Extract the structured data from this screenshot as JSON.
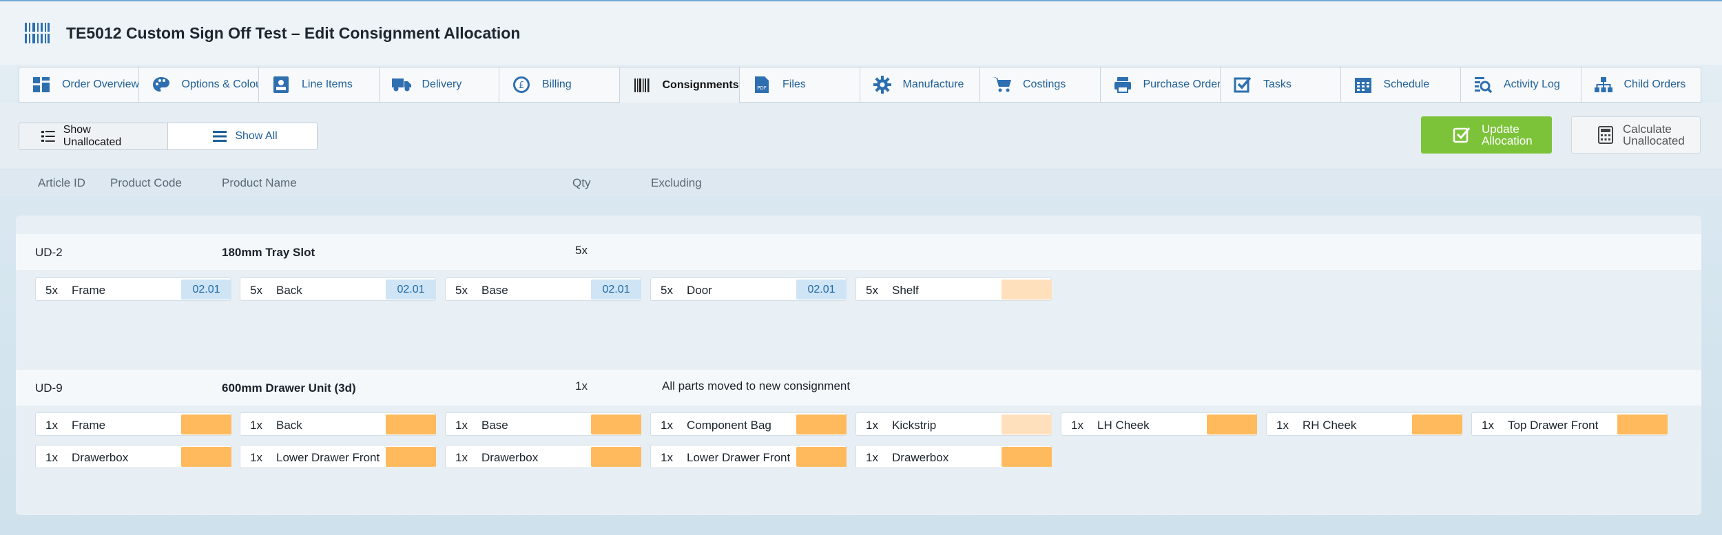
{
  "header": {
    "title": "TE5012 Custom Sign Off Test – Edit Consignment Allocation",
    "logo_icon": "barcode-icon"
  },
  "tabs": [
    {
      "label": "Order Overview",
      "icon": "dashboard-icon"
    },
    {
      "label": "Options & Colours",
      "icon": "palette-icon"
    },
    {
      "label": "Line Items",
      "icon": "id-card-icon"
    },
    {
      "label": "Delivery",
      "icon": "truck-icon"
    },
    {
      "label": "Billing",
      "icon": "pound-coin-icon"
    },
    {
      "label": "Consignments",
      "icon": "barcode-icon",
      "active": true
    },
    {
      "label": "Files",
      "icon": "pdf-file-icon"
    },
    {
      "label": "Manufacture",
      "icon": "gear-icon"
    },
    {
      "label": "Costings",
      "icon": "cart-icon"
    },
    {
      "label": "Purchase Ordering",
      "icon": "printer-icon"
    },
    {
      "label": "Tasks",
      "icon": "checkbox-icon"
    },
    {
      "label": "Schedule",
      "icon": "calendar-icon"
    },
    {
      "label": "Activity Log",
      "icon": "search-list-icon"
    },
    {
      "label": "Child Orders",
      "icon": "hierarchy-icon"
    }
  ],
  "toolbar": {
    "show_unallocated": "Show Unallocated",
    "show_all": "Show All",
    "update_line1": "Update",
    "update_line2": "Allocation",
    "calc_line1": "Calculate",
    "calc_line2": "Unallocated"
  },
  "columns": {
    "article_id": "Article ID",
    "product_code": "Product Code",
    "product_name": "Product Name",
    "qty": "Qty",
    "excluding": "Excluding"
  },
  "groups": [
    {
      "article_id": "UD-2",
      "product_name": "180mm Tray Slot",
      "qty": "5x",
      "note": "",
      "parts": [
        {
          "qty": "5x",
          "name": "Frame",
          "tag": "02.01",
          "status": "blue"
        },
        {
          "qty": "5x",
          "name": "Back",
          "tag": "02.01",
          "status": "blue"
        },
        {
          "qty": "5x",
          "name": "Base",
          "tag": "02.01",
          "status": "blue"
        },
        {
          "qty": "5x",
          "name": "Door",
          "tag": "02.01",
          "status": "blue"
        },
        {
          "qty": "5x",
          "name": "Shelf",
          "tag": "",
          "status": "peach"
        }
      ]
    },
    {
      "article_id": "UD-9",
      "product_name": "600mm Drawer Unit (3d)",
      "qty": "1x",
      "note": "All parts moved to new consignment",
      "parts": [
        {
          "qty": "1x",
          "name": "Frame",
          "tag": "",
          "status": "orange"
        },
        {
          "qty": "1x",
          "name": "Back",
          "tag": "",
          "status": "orange"
        },
        {
          "qty": "1x",
          "name": "Base",
          "tag": "",
          "status": "orange"
        },
        {
          "qty": "1x",
          "name": "Component Bag",
          "tag": "",
          "status": "orange"
        },
        {
          "qty": "1x",
          "name": "Kickstrip",
          "tag": "",
          "status": "peach"
        },
        {
          "qty": "1x",
          "name": "LH Cheek",
          "tag": "",
          "status": "orange"
        },
        {
          "qty": "1x",
          "name": "RH Cheek",
          "tag": "",
          "status": "orange"
        },
        {
          "qty": "1x",
          "name": "Top Drawer Front",
          "tag": "",
          "status": "orange"
        },
        {
          "qty": "1x",
          "name": "Drawerbox",
          "tag": "",
          "status": "orange"
        },
        {
          "qty": "1x",
          "name": "Lower Drawer Front",
          "tag": "",
          "status": "orange"
        },
        {
          "qty": "1x",
          "name": "Drawerbox",
          "tag": "",
          "status": "orange"
        },
        {
          "qty": "1x",
          "name": "Lower Drawer Front",
          "tag": "",
          "status": "orange"
        },
        {
          "qty": "1x",
          "name": "Drawerbox",
          "tag": "",
          "status": "orange"
        }
      ]
    }
  ],
  "colors": {
    "accent_blue": "#1f5f95",
    "update_green": "#7cc33a",
    "tag_blue": "#cfe4f5",
    "tag_orange": "#ffba5e",
    "tag_peach": "#ffe0bd"
  }
}
